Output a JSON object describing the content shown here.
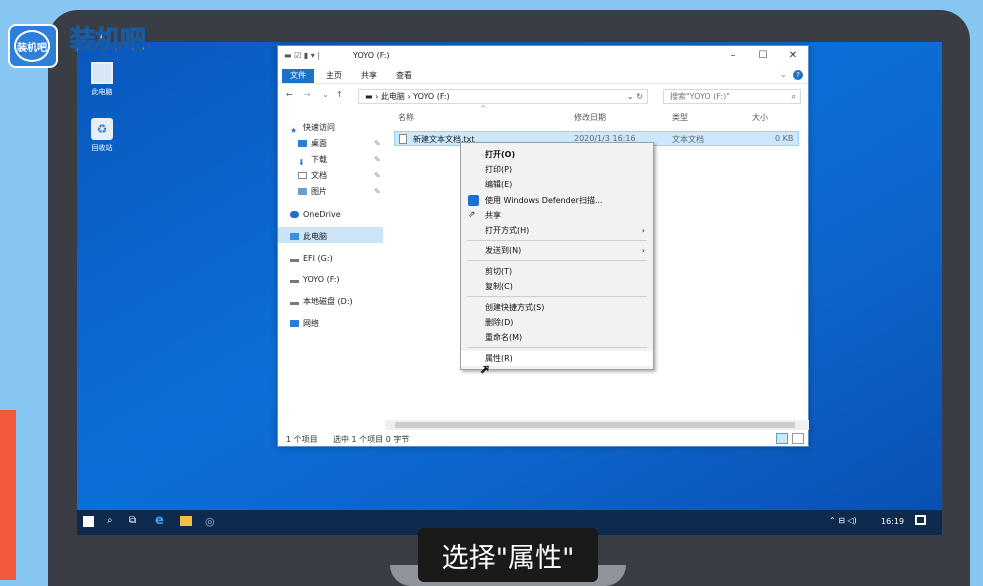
{
  "brand": {
    "logo_circle": "装机吧",
    "logo_text": "装机吧"
  },
  "desktop_icons": [
    {
      "label": "此电脑"
    },
    {
      "label": "回收站"
    }
  ],
  "window": {
    "title": "YOYO (F:)",
    "ribbon_tabs": [
      "文件",
      "主页",
      "共享",
      "查看"
    ],
    "address": [
      "此电脑",
      "YOYO (F:)"
    ],
    "search_placeholder": "搜索\"YOYO (F:)\"",
    "nav_items": [
      "快速访问",
      "桌面",
      "下载",
      "文档",
      "图片",
      "OneDrive",
      "此电脑",
      "EFI (G:)",
      "YOYO (F:)",
      "本地磁盘 (D:)",
      "网络"
    ],
    "columns": [
      "名称",
      "修改日期",
      "类型",
      "大小"
    ],
    "file": {
      "name": "新建文本文档.txt",
      "date": "2020/1/3 16:16",
      "type": "文本文档",
      "size": "0 KB"
    },
    "status_items": "1 个项目",
    "status_selected": "选中 1 个项目 0 字节"
  },
  "context_menu": {
    "items": [
      "打开(O)",
      "打印(P)",
      "编辑(E)",
      "使用 Windows Defender扫描...",
      "共享",
      "打开方式(H)",
      "发送到(N)",
      "剪切(T)",
      "复制(C)",
      "创建快捷方式(S)",
      "删除(D)",
      "重命名(M)",
      "属性(R)"
    ]
  },
  "taskbar": {
    "time": "16:19"
  },
  "caption": "选择\"属性\""
}
